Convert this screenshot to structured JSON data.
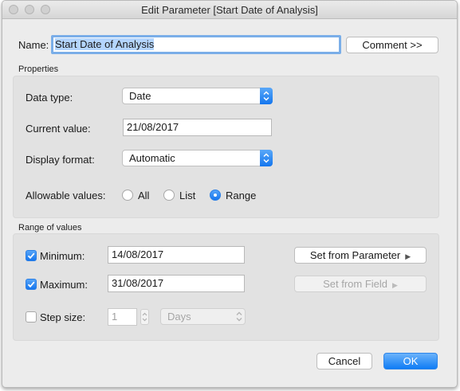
{
  "window": {
    "title": "Edit Parameter [Start Date of Analysis]"
  },
  "name": {
    "label": "Name:",
    "value": "Start Date of Analysis",
    "comment_button": "Comment >>"
  },
  "properties": {
    "section_title": "Properties",
    "data_type": {
      "label": "Data type:",
      "value": "Date"
    },
    "current_value": {
      "label": "Current value:",
      "value": "21/08/2017"
    },
    "display_format": {
      "label": "Display format:",
      "value": "Automatic"
    },
    "allowable_values": {
      "label": "Allowable values:",
      "options": [
        "All",
        "List",
        "Range"
      ],
      "selected": "Range"
    }
  },
  "range": {
    "section_title": "Range of values",
    "minimum": {
      "label": "Minimum:",
      "value": "14/08/2017",
      "checked": true,
      "button": "Set from Parameter"
    },
    "maximum": {
      "label": "Maximum:",
      "value": "31/08/2017",
      "checked": true,
      "button": "Set from Field"
    },
    "step_size": {
      "label": "Step size:",
      "value": "1",
      "checked": false,
      "unit": "Days"
    }
  },
  "buttons": {
    "cancel": "Cancel",
    "ok": "OK"
  },
  "colors": {
    "accent": "#1776ee",
    "selection": "#b4d5fe",
    "focus_ring": "#7aaee8"
  }
}
